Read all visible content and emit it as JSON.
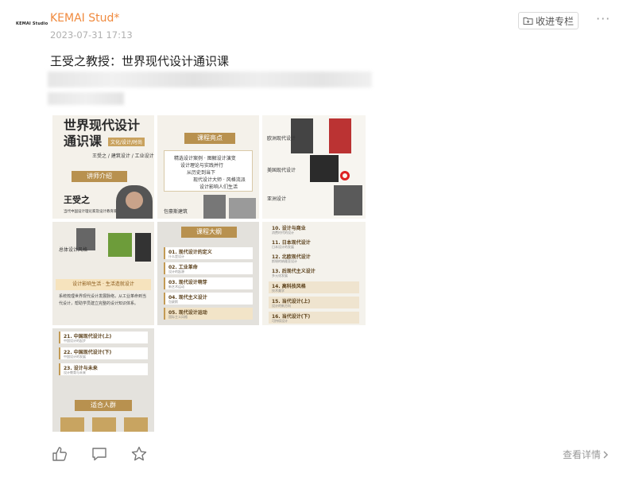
{
  "post": {
    "logo_text": "KEMAI Studio",
    "author": "KEMAI Stud*",
    "time": "2023-07-31 17:13",
    "collect_label": "收进专栏",
    "more_glyph": "···",
    "title": "王受之教授：世界现代设计通识课",
    "details_label": "查看详情"
  },
  "images": {
    "tile1": {
      "title_line1": "世界现代设计",
      "title_line2": "通识课",
      "tag": "文化/设计/时尚",
      "sub": "王受之 / 建筑设计 / 工业设计",
      "banner": "讲师介绍",
      "name": "王受之",
      "caption": "当代中国设计理论家及设计教育家"
    },
    "tile2": {
      "banner": "课程亮点",
      "points": [
        "精选设计案例 · 图解设计演变",
        "设计理论与实践并行",
        "从历史到当下",
        "现代设计大师 · 风格流派",
        "设计影响人们生活"
      ],
      "caption": "包豪斯建筑"
    },
    "tile3": {
      "label1": "欧洲现代设计",
      "label2": "美国现代设计",
      "label3": "亚洲设计"
    },
    "tile4": {
      "label": "总体设计风格",
      "banner": "设计影响生活 · 生活造就设计",
      "body": "系统梳理世界现代设计发展脉络，从工业革命到当代设计，帮助学员建立完整的设计知识体系。"
    },
    "tile5": {
      "banner": "课程大纲",
      "items": [
        {
          "t": "01. 现代设计的定义",
          "s": "什么是设计"
        },
        {
          "t": "02. 工业革命",
          "s": "设计的起源"
        },
        {
          "t": "03. 现代设计萌芽",
          "s": "新艺术运动"
        },
        {
          "t": "04. 现代主义设计",
          "s": "包豪斯"
        },
        {
          "t": "05. 现代设计运动",
          "s": "国际主义风格"
        }
      ]
    },
    "tile6": {
      "items": [
        {
          "t": "10. 设计与商业",
          "s": "消费时代的设计"
        },
        {
          "t": "11. 日本现代设计",
          "s": "日本设计的发展"
        },
        {
          "t": "12. 北欧现代设计",
          "s": "斯堪的纳维亚设计"
        },
        {
          "t": "13. 后现代主义设计",
          "s": "多元化发展"
        },
        {
          "t": "14. 高科技风格",
          "s": "技术美学"
        },
        {
          "t": "15. 当代设计(上)",
          "s": "设计的新方向"
        },
        {
          "t": "16. 当代设计(下)",
          "s": "可持续设计"
        }
      ]
    },
    "tile7": {
      "items": [
        {
          "t": "21. 中国现代设计(上)",
          "s": "中国设计的起步"
        },
        {
          "t": "22. 中国现代设计(下)",
          "s": "中国设计的发展"
        },
        {
          "t": "23. 设计与未来",
          "s": "设计教育与未来"
        }
      ],
      "banner": "适合人群"
    }
  },
  "colors": {
    "author": "#f08a3e",
    "accent_gold": "#b8914f"
  }
}
